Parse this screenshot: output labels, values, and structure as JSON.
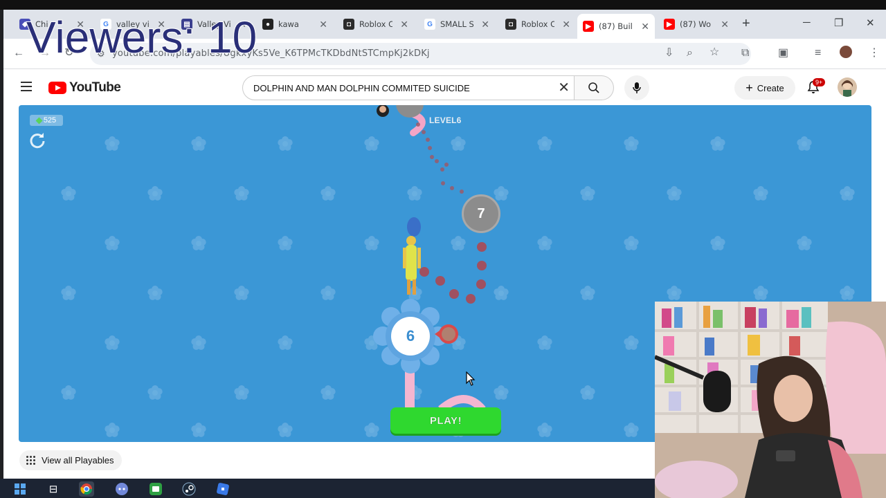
{
  "overlay": {
    "viewers": "Viewers: 10"
  },
  "browser": {
    "tabs": [
      {
        "title": "Chi",
        "icon": "chat-icon",
        "color": "#4a4fb8",
        "active": false
      },
      {
        "title": "valley vi",
        "icon": "google-icon",
        "color": "#4285f4",
        "active": false
      },
      {
        "title": "Valley Vi",
        "icon": "book-icon",
        "color": "#3b3f8f",
        "active": false
      },
      {
        "title": "kawa",
        "icon": "circle-logo-icon",
        "color": "#222222",
        "active": false
      },
      {
        "title": "Roblox C",
        "icon": "roblox-icon",
        "color": "#2b2b2b",
        "active": false
      },
      {
        "title": "SMALL S",
        "icon": "google-icon",
        "color": "#4285f4",
        "active": false
      },
      {
        "title": "Roblox C",
        "icon": "roblox-icon",
        "color": "#2b2b2b",
        "active": false
      },
      {
        "title": "(87) Buil",
        "icon": "youtube-icon",
        "color": "#ff0000",
        "active": true
      },
      {
        "title": "(87) Wo",
        "icon": "youtube-icon",
        "color": "#ff0000",
        "active": false
      }
    ],
    "url": "youtube.com/playables/UgkxyKs5Ve_K6TPMcTKDbdNtSTCmpKj2kDKj"
  },
  "youtube": {
    "logo_text": "YouTube",
    "search_value": "DOLPHIN AND MAN DOLPHIN COMMITED SUICIDE",
    "create_label": "Create",
    "notifications_badge": "9+",
    "view_all_label": "View all Playables"
  },
  "game": {
    "coins": "525",
    "level_label": "LEVEL6",
    "next_level": "7",
    "current_level": "6",
    "play_label": "PLAY!"
  }
}
